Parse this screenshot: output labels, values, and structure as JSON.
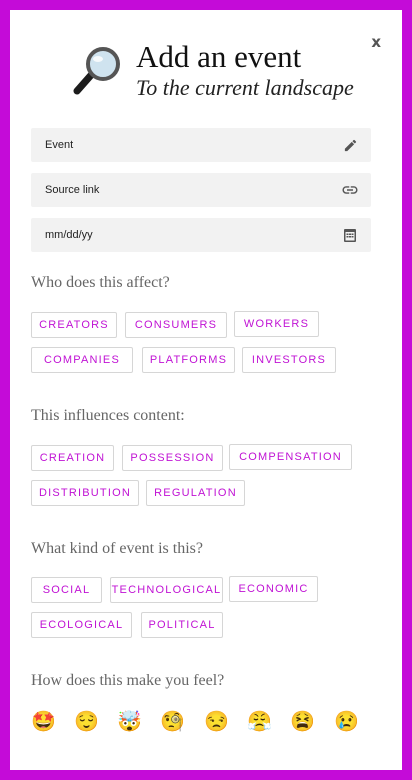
{
  "modal": {
    "close_label": "x",
    "title": "Add an event",
    "subtitle": "To the current landscape",
    "header_icon": "magnifier-icon"
  },
  "fields": {
    "event_placeholder": "Event",
    "source_placeholder": "Source link",
    "date_placeholder": "mm/dd/yy"
  },
  "sections": {
    "affect": {
      "question": "Who does this affect?",
      "options": [
        "CREATORS",
        "CONSUMERS",
        "WORKERS",
        "COMPANIES",
        "PLATFORMS",
        "INVESTORS"
      ]
    },
    "content": {
      "question": "This influences content:",
      "options": [
        "CREATION",
        "POSSESSION",
        "COMPENSATION",
        "DISTRIBUTION",
        "REGULATION"
      ]
    },
    "kind": {
      "question": "What kind of event is this?",
      "options": [
        "SOCIAL",
        "TECHNOLOGICAL",
        "ECONOMIC",
        "ECOLOGICAL",
        "POLITICAL"
      ]
    },
    "feel": {
      "question": "How does this make you feel?",
      "emojis": [
        "🤩",
        "😌",
        "🤯",
        "🧐",
        "😒",
        "😤",
        "😫",
        "😢"
      ]
    }
  },
  "colors": {
    "accent": "#c012d4",
    "frame": "#c40bd8",
    "field_bg": "#f2f2f2"
  }
}
